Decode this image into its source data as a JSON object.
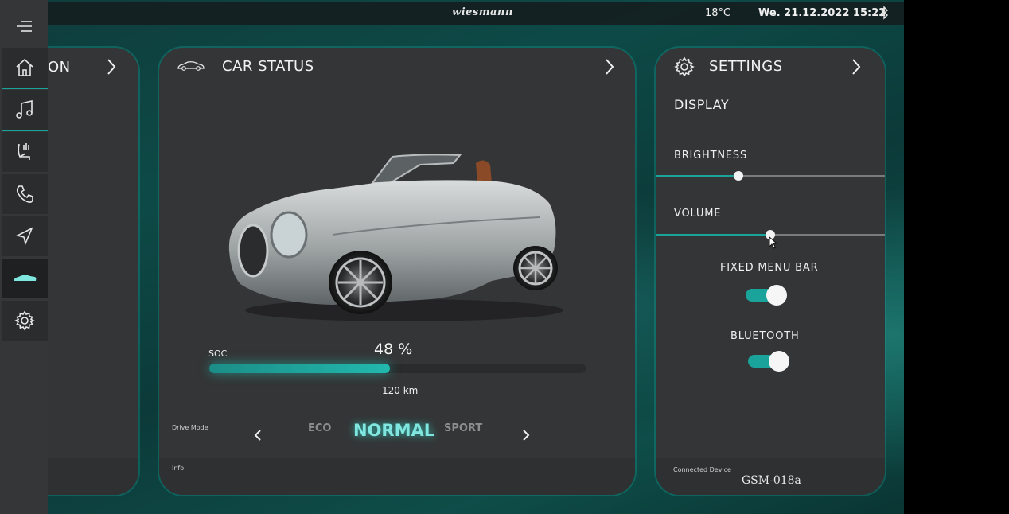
{
  "status_bar": {
    "brand": "wiesmann",
    "temperature": "18°C",
    "datetime": "We. 21.12.2022 15:22",
    "bluetooth_icon": "bluetooth-icon"
  },
  "sidebar": {
    "items": [
      {
        "icon": "menu-icon"
      },
      {
        "icon": "home-icon"
      },
      {
        "icon": "music-icon"
      },
      {
        "icon": "seat-icon"
      },
      {
        "icon": "phone-icon"
      },
      {
        "icon": "navigation-icon"
      },
      {
        "icon": "car-icon",
        "active": true
      },
      {
        "icon": "gear-icon"
      }
    ]
  },
  "left_panel": {
    "title": "ON"
  },
  "car_status": {
    "title": "CAR STATUS",
    "soc_label": "SOC",
    "soc_value": "48 %",
    "soc_fraction": 0.48,
    "range": "120 km",
    "drive_mode_label": "Drive Mode",
    "modes": [
      "ECO",
      "NORMAL",
      "SPORT"
    ],
    "active_mode": "NORMAL",
    "info_label": "Info"
  },
  "settings": {
    "title": "SETTINGS",
    "display_heading": "DISPLAY",
    "brightness_label": "BRIGHTNESS",
    "brightness_level": 0.36,
    "volume_label": "VOLUME",
    "volume_level": 0.5,
    "fixed_menu_bar_label": "FIXED MENU BAR",
    "fixed_menu_bar_on": true,
    "bluetooth_label": "BLUETOOTH",
    "bluetooth_on": true,
    "connected_device_label": "Connected Device",
    "connected_device": "GSM-018a"
  },
  "colors": {
    "accent": "#1aa39b",
    "panel": "#343536",
    "sidebar": "#353637",
    "glow": "#7fe7df"
  }
}
